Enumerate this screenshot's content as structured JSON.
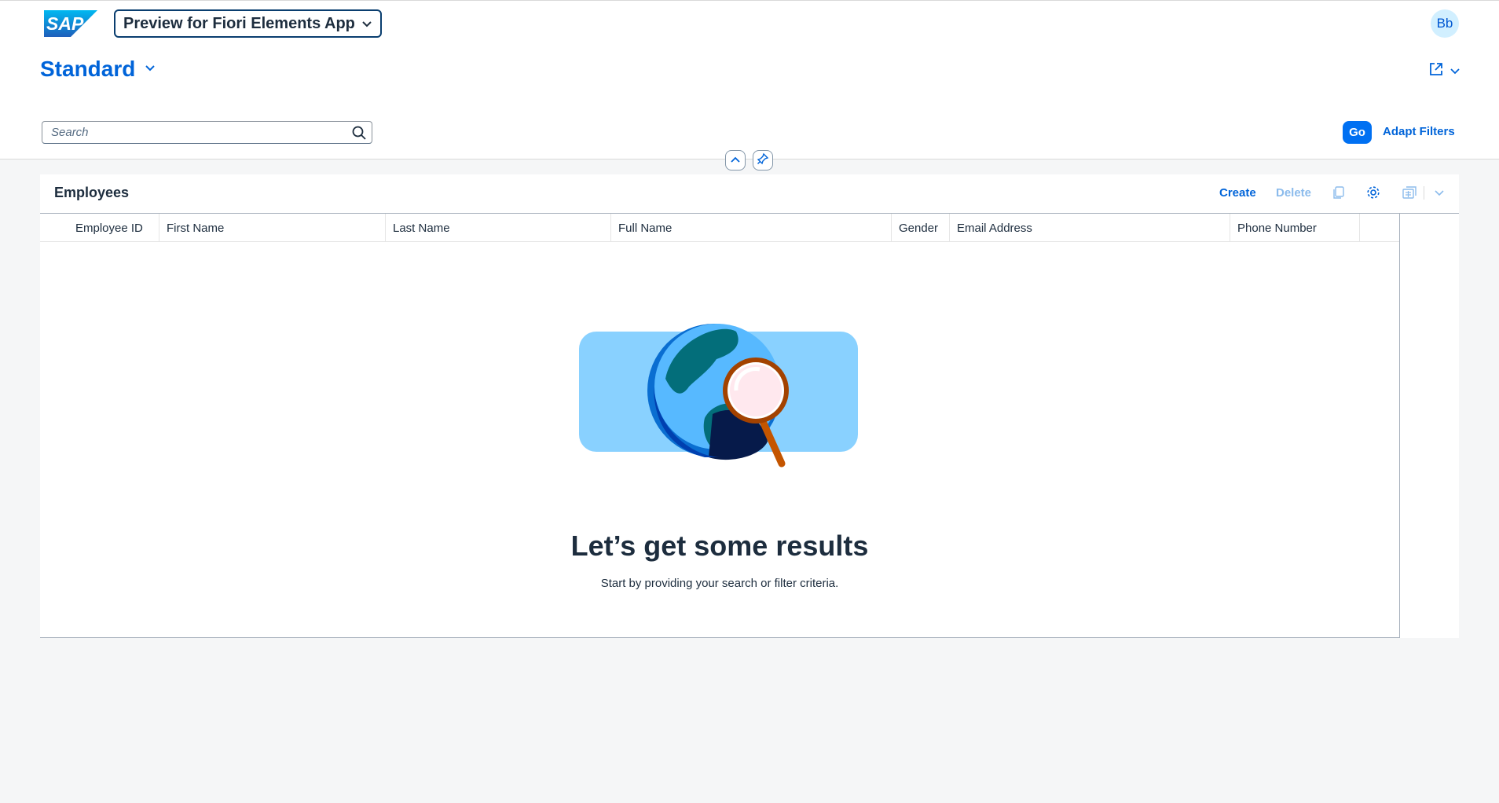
{
  "shell": {
    "logo_text": "SAP",
    "app_title": "Preview for Fiori Elements App",
    "avatar_initials": "Bb"
  },
  "header": {
    "variant_title": "Standard",
    "search_placeholder": "Search",
    "go_label": "Go",
    "adapt_filters_label": "Adapt Filters"
  },
  "table": {
    "title": "Employees",
    "create_label": "Create",
    "delete_label": "Delete",
    "columns": [
      "Employee ID",
      "First Name",
      "Last Name",
      "Full Name",
      "Gender",
      "Email Address",
      "Phone Number"
    ],
    "rows": []
  },
  "empty_state": {
    "title": "Let’s get some results",
    "subtitle": "Start by providing your search or filter criteria."
  },
  "colors": {
    "brand_blue": "#0064d9",
    "button_blue": "#0070f2",
    "disabled_blue": "#8bbbec",
    "page_bg": "#f5f6f7"
  },
  "icons": [
    "sap-logo",
    "chevron-down-icon",
    "share-icon",
    "search-icon",
    "collapse-header-icon",
    "pin-icon",
    "copy-icon",
    "settings-icon",
    "export-icon"
  ]
}
